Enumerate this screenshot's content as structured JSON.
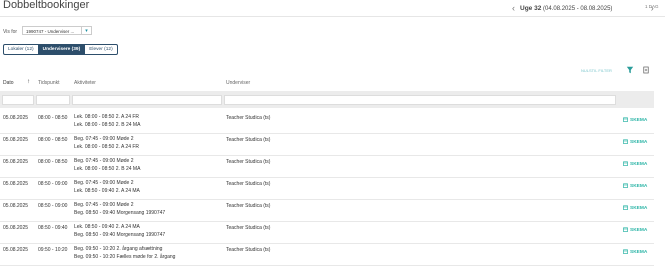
{
  "header": {
    "title": "Dobbeltbookinger",
    "week_label": "Uge 32",
    "week_range": "(04.08.2025 - 08.08.2025)",
    "day_label": "1 DAG"
  },
  "filter": {
    "vis_for_label": "Vis for",
    "select_value": "1990747 - Underviser ..."
  },
  "tabs": [
    {
      "label": "Lokaler (12)",
      "active": false
    },
    {
      "label": "Undervisere (39)",
      "active": true
    },
    {
      "label": "Elever (12)",
      "active": false
    }
  ],
  "toolbar": {
    "nulstil": "NULSTIL FILTER"
  },
  "columns": {
    "dato": "Dato",
    "tidspunkt": "Tidspunkt",
    "aktiviteter": "Aktiviteter",
    "underviser": "Underviser"
  },
  "rows": [
    {
      "dato": "05.08.2025",
      "tid": "08:00 - 08:50",
      "a1": "Lek.   08:00 - 08:50   2. A 24 FR",
      "a2": "Lek.   08:00 - 08:50   2. B 24 MA",
      "underviser": "Teacher Studica (ts)",
      "skema": "SKEMA"
    },
    {
      "dato": "05.08.2025",
      "tid": "08:00 - 08:50",
      "a1": "Beg.   07:45 - 09:00   Møde 2",
      "a2": "Lek.   08:00 - 08:50   2. A 24 FR",
      "underviser": "Teacher Studica (ts)",
      "skema": "SKEMA"
    },
    {
      "dato": "05.08.2025",
      "tid": "08:00 - 08:50",
      "a1": "Beg.   07:45 - 09:00   Møde 2",
      "a2": "Lek.   08:00 - 08:50   2. B 24 MA",
      "underviser": "Teacher Studica (ts)",
      "skema": "SKEMA"
    },
    {
      "dato": "05.08.2025",
      "tid": "08:50 - 09:00",
      "a1": "Beg.   07:45 - 09:00   Møde 2",
      "a2": "Lek.   08:50 - 09:40   2. A 24 MA",
      "underviser": "Teacher Studica (ts)",
      "skema": "SKEMA"
    },
    {
      "dato": "05.08.2025",
      "tid": "08:50 - 09:00",
      "a1": "Beg.   07:45 - 09:00   Møde 2",
      "a2": "Beg.   08:50 - 09:40   Morgensang 1990747",
      "underviser": "Teacher Studica (ts)",
      "skema": "SKEMA"
    },
    {
      "dato": "05.08.2025",
      "tid": "08:50 - 09:40",
      "a1": "Lek.   08:50 - 09:40   2. A 24 MA",
      "a2": "Beg.   08:50 - 09:40   Morgensang 1990747",
      "underviser": "Teacher Studica (ts)",
      "skema": "SKEMA"
    },
    {
      "dato": "05.08.2025",
      "tid": "09:50 - 10:20",
      "a1": "Beg.   09:50 - 10:20   2. årgang afsættning",
      "a2": "Beg.   09:50 - 10:20   Fælles møde for 2. årgang",
      "underviser": "Teacher Studica (ts)",
      "skema": "SKEMA"
    }
  ],
  "colors": {
    "accent": "#2bb4a6",
    "tab_active": "#2d4e6b"
  },
  "icons": [
    "chevron-left-icon",
    "chevron-right-icon",
    "chevron-down-icon",
    "sort-up-icon",
    "filter-icon",
    "export-icon",
    "calendar-icon"
  ]
}
